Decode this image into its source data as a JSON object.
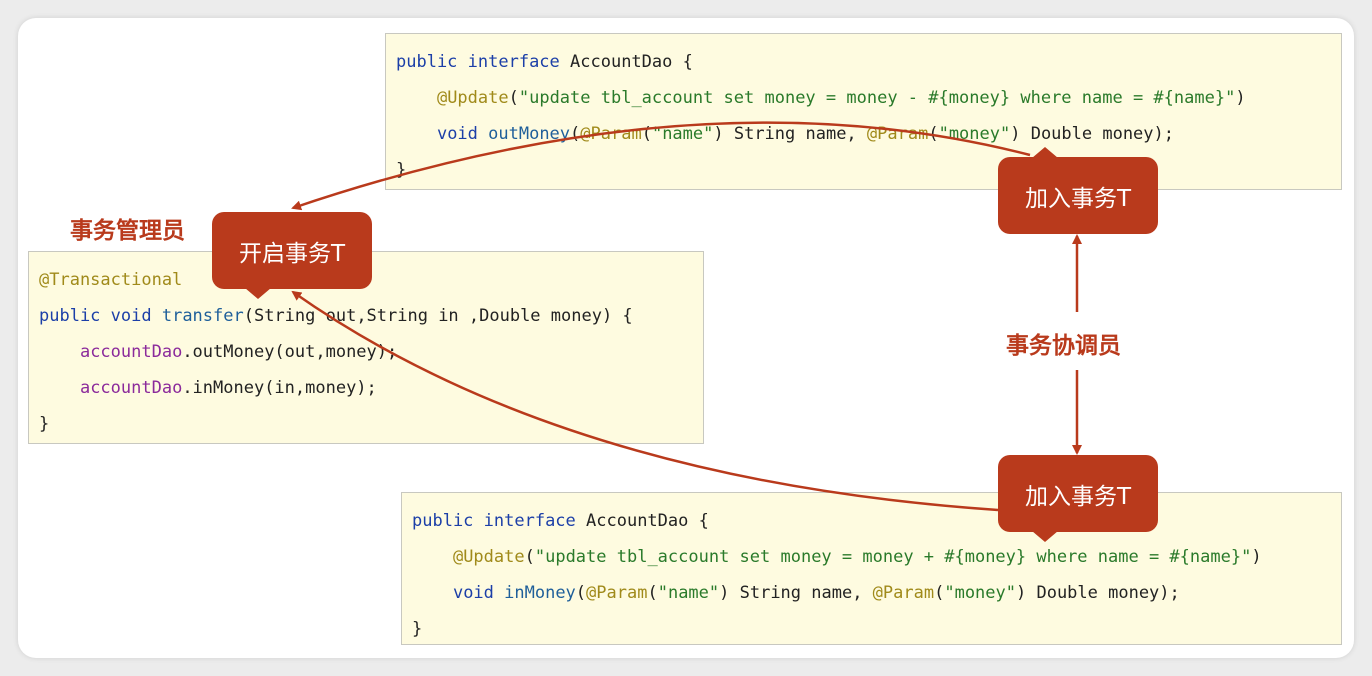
{
  "code_top": [
    [
      [
        "public ",
        "kw"
      ],
      [
        "interface ",
        "kw"
      ],
      [
        "AccountDao {",
        "pl"
      ]
    ],
    [
      [
        "    ",
        "pl"
      ],
      [
        "@Update",
        "an"
      ],
      [
        "(",
        "pl"
      ],
      [
        "\"update tbl_account set money = money - #{money} where name = #{name}\"",
        "st"
      ],
      [
        ")",
        "pl"
      ]
    ],
    [
      [
        "    ",
        "pl"
      ],
      [
        "void ",
        "kw"
      ],
      [
        "outMoney",
        "fn"
      ],
      [
        "(",
        "pl"
      ],
      [
        "@Param",
        "an"
      ],
      [
        "(",
        "pl"
      ],
      [
        "\"name\"",
        "st"
      ],
      [
        ") String name, ",
        "pl"
      ],
      [
        "@Param",
        "an"
      ],
      [
        "(",
        "pl"
      ],
      [
        "\"money\"",
        "st"
      ],
      [
        ") Double money);",
        "pl"
      ]
    ],
    [
      [
        "}",
        "pl"
      ]
    ]
  ],
  "code_left": [
    [
      [
        "@Transactional",
        "an"
      ]
    ],
    [
      [
        "public ",
        "kw"
      ],
      [
        "void ",
        "kw"
      ],
      [
        "transfer",
        "fn"
      ],
      [
        "(String out,String in ,Double money) {",
        "pl"
      ]
    ],
    [
      [
        "    ",
        "pl"
      ],
      [
        "accountDao",
        "fd"
      ],
      [
        ".outMoney(out,money);",
        "pl"
      ]
    ],
    [
      [
        "    ",
        "pl"
      ],
      [
        "accountDao",
        "fd"
      ],
      [
        ".inMoney(in,money);",
        "pl"
      ]
    ],
    [
      [
        "}",
        "pl"
      ]
    ]
  ],
  "code_bottom": [
    [
      [
        "public ",
        "kw"
      ],
      [
        "interface ",
        "kw"
      ],
      [
        "AccountDao {",
        "pl"
      ]
    ],
    [
      [
        "    ",
        "pl"
      ],
      [
        "@Update",
        "an"
      ],
      [
        "(",
        "pl"
      ],
      [
        "\"update tbl_account set money = money + #{money} where name = #{name}\"",
        "st"
      ],
      [
        ")",
        "pl"
      ]
    ],
    [
      [
        "    ",
        "pl"
      ],
      [
        "void ",
        "kw"
      ],
      [
        "inMoney",
        "fn"
      ],
      [
        "(",
        "pl"
      ],
      [
        "@Param",
        "an"
      ],
      [
        "(",
        "pl"
      ],
      [
        "\"name\"",
        "st"
      ],
      [
        ") String name, ",
        "pl"
      ],
      [
        "@Param",
        "an"
      ],
      [
        "(",
        "pl"
      ],
      [
        "\"money\"",
        "st"
      ],
      [
        ") Double money);",
        "pl"
      ]
    ],
    [
      [
        "}",
        "pl"
      ]
    ]
  ],
  "labels": {
    "manager": "事务管理员",
    "coordinator": "事务协调员",
    "start": "开启事务T",
    "join_top": "加入事务T",
    "join_bottom": "加入事务T"
  },
  "colors": {
    "accent": "#b93a1c",
    "code_bg": "#fefbe0"
  }
}
